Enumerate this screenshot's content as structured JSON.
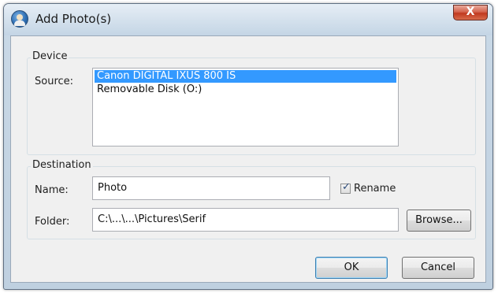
{
  "window": {
    "title": "Add Photo(s)",
    "close_glyph": "X"
  },
  "device": {
    "group_title": "Device",
    "source_label": "Source:",
    "sources": [
      {
        "label": "Canon DIGITAL IXUS 800 IS",
        "selected": true
      },
      {
        "label": "Removable Disk (O:)",
        "selected": false
      }
    ]
  },
  "destination": {
    "group_title": "Destination",
    "name_label": "Name:",
    "name_value": "Photo",
    "rename_label": "Rename",
    "rename_checked": true,
    "folder_label": "Folder:",
    "folder_value": "C:\\...\\...\\Pictures\\Serif",
    "browse_label": "Browse..."
  },
  "buttons": {
    "ok": "OK",
    "cancel": "Cancel"
  },
  "colors": {
    "selection": "#3399ff",
    "close_button": "#c0391f"
  },
  "icons": {
    "app": "camera-person-icon",
    "close": "close-icon",
    "check": "checkmark-icon"
  }
}
